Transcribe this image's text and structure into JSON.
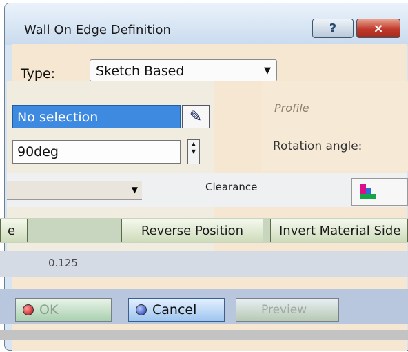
{
  "window": {
    "title": "Wall On Edge Definition",
    "help_label": "?",
    "close_label": "×"
  },
  "type_row": {
    "label": "Type:",
    "value": "Sketch Based"
  },
  "selection": {
    "value": "No selection"
  },
  "rotation": {
    "value": "90deg"
  },
  "right_labels": {
    "profile": "Profile",
    "rotation_angle": "Rotation angle:"
  },
  "clearance": {
    "label": "Clearance"
  },
  "buttons": {
    "partial_label": "e",
    "reverse_position": "Reverse Position",
    "invert_material_side": "Invert Material Side"
  },
  "field_value": "0.125",
  "dialog": {
    "ok": "OK",
    "cancel": "Cancel",
    "preview": "Preview"
  }
}
